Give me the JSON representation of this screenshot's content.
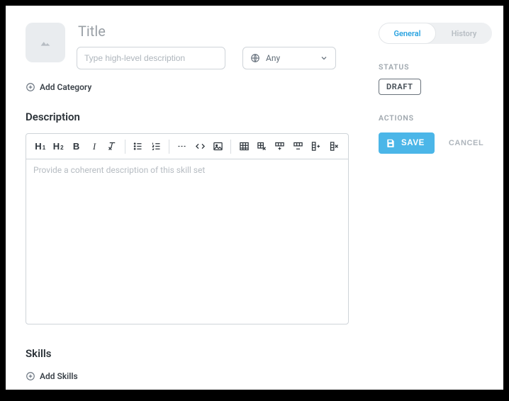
{
  "header": {
    "title_placeholder": "Title",
    "desc_placeholder": "Type high-level description",
    "type_value": "Any",
    "add_category_label": "Add Category"
  },
  "description": {
    "section_heading": "Description",
    "body_placeholder": "Provide a coherent description of this skill set",
    "toolbar": {
      "h1": "H",
      "h1_sub": "1",
      "h2": "H",
      "h2_sub": "2",
      "bold": "B",
      "italic": "I"
    }
  },
  "skills": {
    "section_heading": "Skills",
    "add_label": "Add Skills"
  },
  "side": {
    "tabs": {
      "general": "General",
      "history": "History"
    },
    "status_label": "STATUS",
    "status_value": "DRAFT",
    "actions_label": "ACTIONS",
    "save_label": "SAVE",
    "cancel_label": "CANCEL"
  }
}
